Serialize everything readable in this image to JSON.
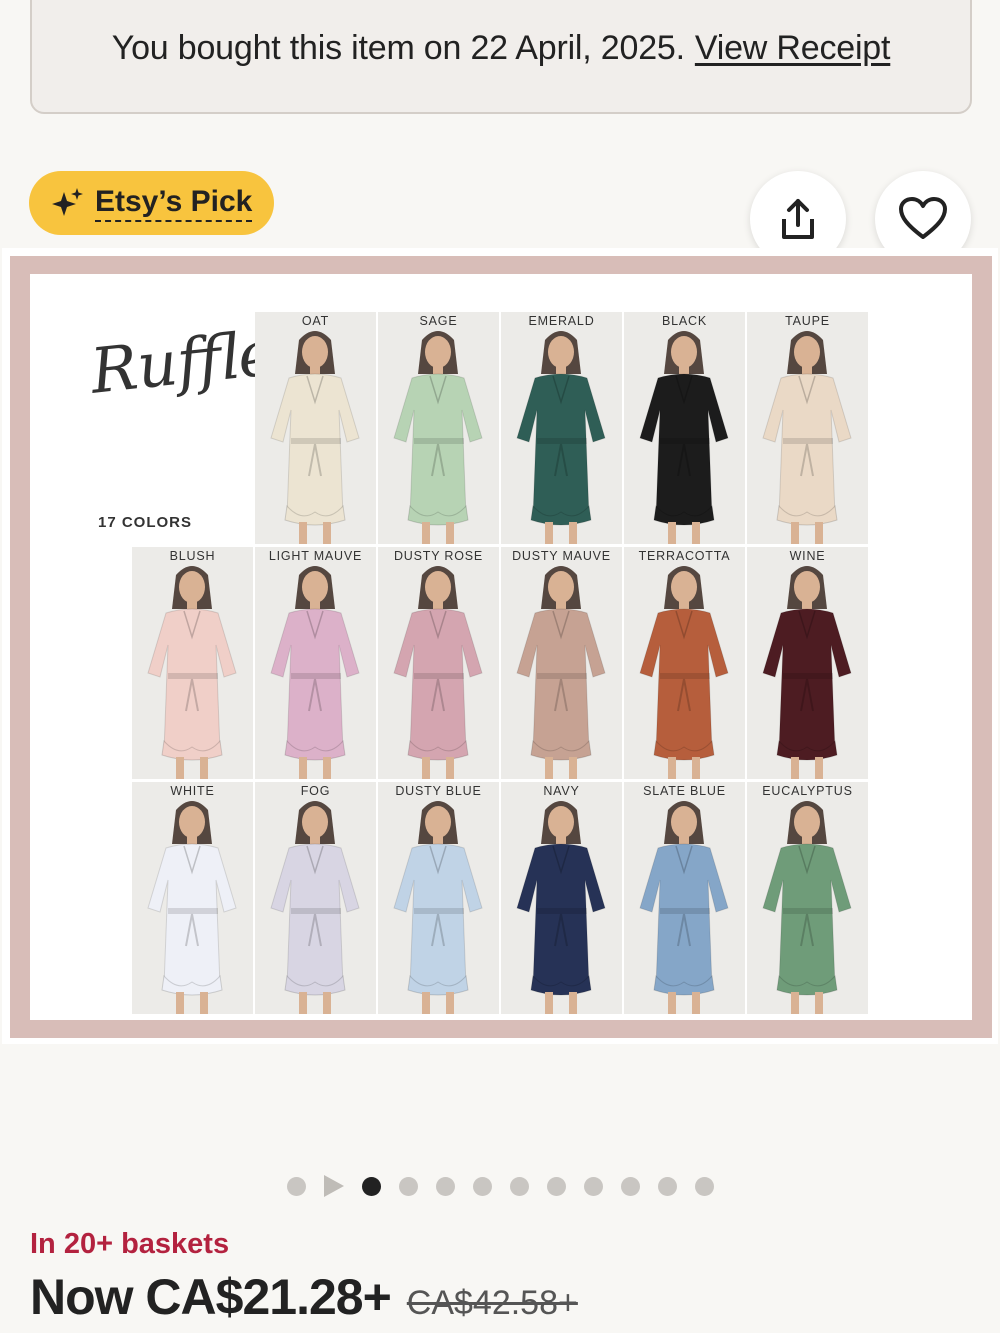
{
  "receipt": {
    "text": "You bought this item on 22 April, 2025.",
    "link_label": "View Receipt"
  },
  "badge": {
    "label": "Etsy’s Pick",
    "icon": "sparkle-icon",
    "color": "#f8c43e"
  },
  "actions": {
    "share_icon": "share-icon",
    "favorite_icon": "heart-icon"
  },
  "listing_image": {
    "title": "Ruffle Robe",
    "subtitle": "17 COLORS",
    "swatches": [
      {
        "label": "OAT",
        "color": "#ece4d2"
      },
      {
        "label": "SAGE",
        "color": "#b7d3b4"
      },
      {
        "label": "EMERALD",
        "color": "#2f5e56"
      },
      {
        "label": "BLACK",
        "color": "#1c1c1c"
      },
      {
        "label": "TAUPE",
        "color": "#ead9c6"
      },
      {
        "label": "BLUSH",
        "color": "#f0cfc8"
      },
      {
        "label": "LIGHT MAUVE",
        "color": "#dcb1c9"
      },
      {
        "label": "DUSTY ROSE",
        "color": "#d4a5b0"
      },
      {
        "label": "DUSTY MAUVE",
        "color": "#c6a293"
      },
      {
        "label": "TERRACOTTA",
        "color": "#b65e3c"
      },
      {
        "label": "WINE",
        "color": "#4d1c22"
      },
      {
        "label": "WHITE",
        "color": "#eef0f7"
      },
      {
        "label": "FOG",
        "color": "#d8d5e3"
      },
      {
        "label": "DUSTY BLUE",
        "color": "#c0d3e6"
      },
      {
        "label": "NAVY",
        "color": "#263256"
      },
      {
        "label": "SLATE BLUE",
        "color": "#85a6c8"
      },
      {
        "label": "EUCALYPTUS",
        "color": "#6f9c79"
      }
    ]
  },
  "carousel": {
    "total": 12,
    "active_index": 2
  },
  "social_proof": "In 20+ baskets",
  "price": {
    "now": "Now CA$21.28+",
    "original": "CA$42.58+"
  }
}
